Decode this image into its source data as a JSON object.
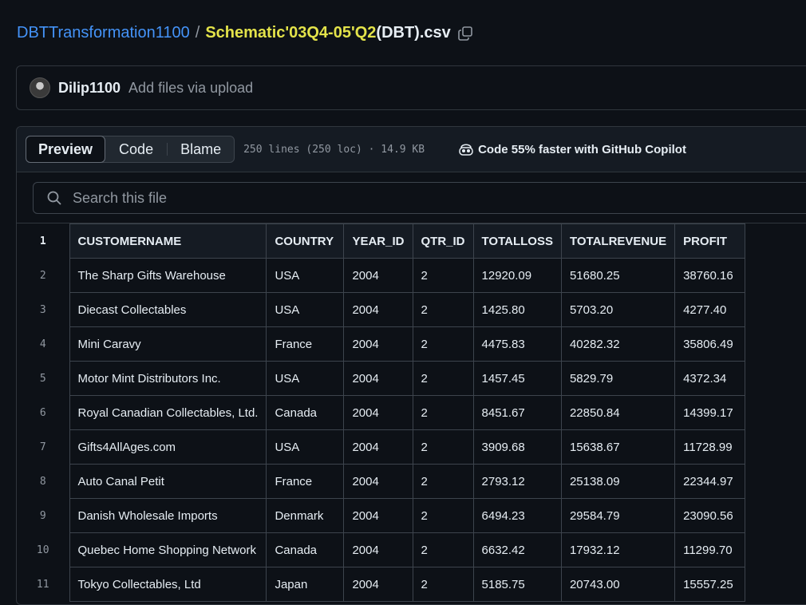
{
  "breadcrumb": {
    "repo": "DBTTransformation1100",
    "separator": "/",
    "file_hl": "Schematic'03Q4-05'Q2",
    "file_rest": "(DBT).csv"
  },
  "commit": {
    "user": "Dilip1100",
    "message": "Add files via upload"
  },
  "toolbar": {
    "preview": "Preview",
    "code": "Code",
    "blame": "Blame",
    "info": "250 lines (250 loc) · 14.9 KB",
    "copilot": "Code 55% faster with GitHub Copilot"
  },
  "search": {
    "placeholder": "Search this file"
  },
  "table": {
    "header_line": "1",
    "columns": [
      "CUSTOMERNAME",
      "COUNTRY",
      "YEAR_ID",
      "QTR_ID",
      "TOTALLOSS",
      "TOTALREVENUE",
      "PROFIT"
    ],
    "rows": [
      {
        "line": "2",
        "cells": [
          "The Sharp Gifts Warehouse",
          "USA",
          "2004",
          "2",
          "12920.09",
          "51680.25",
          "38760.16"
        ]
      },
      {
        "line": "3",
        "cells": [
          "Diecast Collectables",
          "USA",
          "2004",
          "2",
          "1425.80",
          "5703.20",
          "4277.40"
        ]
      },
      {
        "line": "4",
        "cells": [
          "Mini Caravy",
          "France",
          "2004",
          "2",
          "4475.83",
          "40282.32",
          "35806.49"
        ]
      },
      {
        "line": "5",
        "cells": [
          "Motor Mint Distributors Inc.",
          "USA",
          "2004",
          "2",
          "1457.45",
          "5829.79",
          "4372.34"
        ]
      },
      {
        "line": "6",
        "cells": [
          "Royal Canadian Collectables, Ltd.",
          "Canada",
          "2004",
          "2",
          "8451.67",
          "22850.84",
          "14399.17"
        ]
      },
      {
        "line": "7",
        "cells": [
          "Gifts4AllAges.com",
          "USA",
          "2004",
          "2",
          "3909.68",
          "15638.67",
          "11728.99"
        ]
      },
      {
        "line": "8",
        "cells": [
          "Auto Canal Petit",
          "France",
          "2004",
          "2",
          "2793.12",
          "25138.09",
          "22344.97"
        ]
      },
      {
        "line": "9",
        "cells": [
          "Danish Wholesale Imports",
          "Denmark",
          "2004",
          "2",
          "6494.23",
          "29584.79",
          "23090.56"
        ]
      },
      {
        "line": "10",
        "cells": [
          "Quebec Home Shopping Network",
          "Canada",
          "2004",
          "2",
          "6632.42",
          "17932.12",
          "11299.70"
        ]
      },
      {
        "line": "11",
        "cells": [
          "Tokyo Collectables, Ltd",
          "Japan",
          "2004",
          "2",
          "5185.75",
          "20743.00",
          "15557.25"
        ]
      }
    ]
  }
}
